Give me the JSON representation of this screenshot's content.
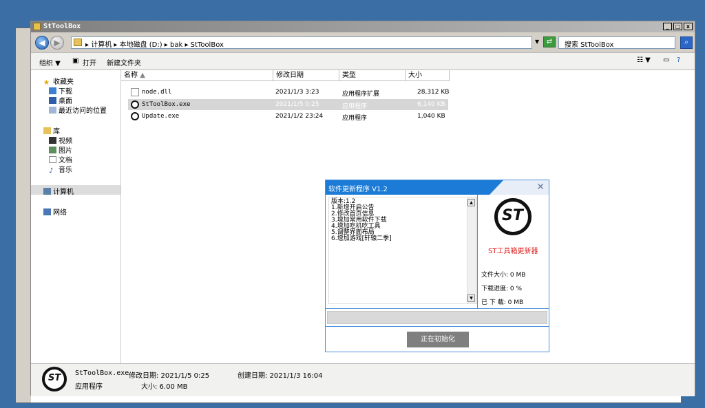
{
  "window": {
    "title": "StToolBox",
    "controls": {
      "minimize": "_",
      "maximize": "□",
      "close": "x"
    }
  },
  "address": {
    "breadcrumb": "▸ 计算机 ▸ 本地磁盘 (D:) ▸ bak ▸ StToolBox",
    "search_placeholder": "搜索 StToolBox"
  },
  "toolbar": {
    "organize": "组织 ▼",
    "open": "打开",
    "new_folder": "新建文件夹"
  },
  "nav": {
    "favorites": "收藏夹",
    "downloads": "下载",
    "desktop": "桌面",
    "recent": "最近访问的位置",
    "libraries": "库",
    "videos": "视频",
    "pictures": "图片",
    "documents": "文档",
    "music": "音乐",
    "computer": "计算机",
    "network": "网络"
  },
  "columns": {
    "name": "名称",
    "modified": "修改日期",
    "type": "类型",
    "size": "大小"
  },
  "files": [
    {
      "name": "node.dll",
      "modified": "2021/1/3 3:23",
      "type": "应用程序扩展",
      "size": "28,312 KB"
    },
    {
      "name": "StToolBox.exe",
      "modified": "2021/1/5 0:25",
      "type": "应用程序",
      "size": "6,140 KB"
    },
    {
      "name": "Update.exe",
      "modified": "2021/1/2 23:24",
      "type": "应用程序",
      "size": "1,040 KB"
    }
  ],
  "status": {
    "filename": "StToolBox.exe",
    "modified_label": "修改日期: 2021/1/5 0:25",
    "created_label": "创建日期: 2021/1/3 16:04",
    "type": "应用程序",
    "size_label": "大小: 6.00 MB"
  },
  "dialog": {
    "title": "软件更新程序 V1.2",
    "close": "✕",
    "notes": "版本:1.2\n1.新增开启公告\n2.修改首页信息\n3.增加常用软件下载\n4.增加吃机吃工具\n5.调整界面布局\n6.增加游戏[轩辕二季]",
    "logo_text": "ST",
    "brand": "ST工具箱更新器",
    "file_size": "文件大小: 0 MB",
    "progress_text": "下载进度: 0 %",
    "downloaded": "已 下 载: 0 MB",
    "progress_value": 0,
    "button": "正在初始化"
  }
}
